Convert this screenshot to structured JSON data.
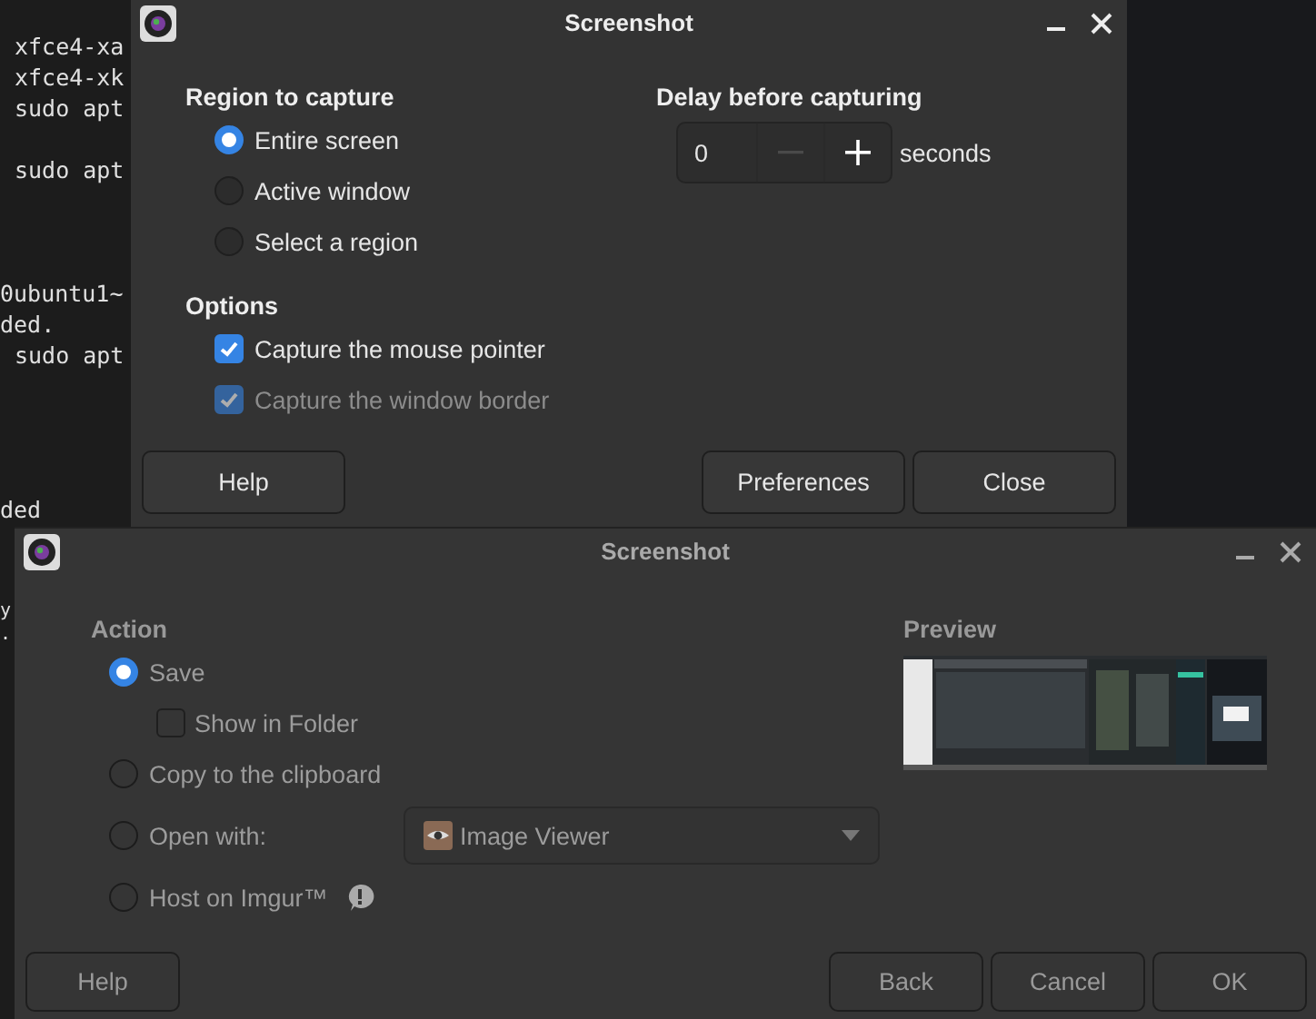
{
  "terminal": {
    "blocks": [
      [
        "xfce4-xa",
        "xfce4-xk",
        "sudo apt"
      ],
      [
        "sudo apt"
      ],
      [
        "0ubuntu1~",
        "ded.",
        "sudo apt"
      ],
      [
        "ded"
      ]
    ],
    "lower_lines": [
      "y",
      "."
    ]
  },
  "capture_dialog": {
    "title": "Screenshot",
    "active": true,
    "region": {
      "heading": "Region to capture",
      "choices": [
        {
          "label": "Entire screen",
          "selected": true
        },
        {
          "label": "Active window",
          "selected": false
        },
        {
          "label": "Select a region",
          "selected": false
        }
      ]
    },
    "options": {
      "heading": "Options",
      "items": [
        {
          "label": "Capture the mouse pointer",
          "checked": true,
          "disabled": false
        },
        {
          "label": "Capture the window border",
          "checked": true,
          "disabled": true
        }
      ]
    },
    "delay": {
      "heading": "Delay before capturing",
      "value": "0",
      "decrement_disabled": true,
      "unit": "seconds"
    },
    "buttons": [
      "Help",
      "Preferences",
      "Close"
    ]
  },
  "action_dialog": {
    "title": "Screenshot",
    "active": false,
    "action": {
      "heading": "Action",
      "choices": [
        {
          "label": "Save",
          "selected": true,
          "kind": "radio"
        },
        {
          "label": "Show in Folder",
          "checked": false,
          "kind": "check"
        },
        {
          "label": "Copy to the clipboard",
          "selected": false,
          "kind": "radio"
        },
        {
          "label": "Open with:",
          "selected": false,
          "kind": "dropdown",
          "value": "Image Viewer"
        },
        {
          "label": "Host on Imgur™",
          "selected": false,
          "kind": "info"
        }
      ]
    },
    "preview": {
      "heading": "Preview",
      "kind": "picture"
    },
    "buttons": [
      "Help",
      "Back",
      "Cancel",
      "OK"
    ]
  }
}
